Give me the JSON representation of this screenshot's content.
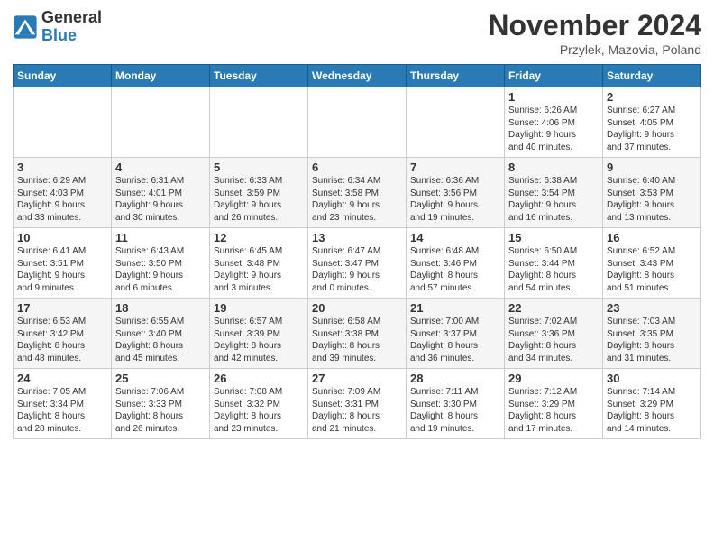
{
  "logo": {
    "general": "General",
    "blue": "Blue"
  },
  "title": "November 2024",
  "location": "Przylek, Mazovia, Poland",
  "headers": [
    "Sunday",
    "Monday",
    "Tuesday",
    "Wednesday",
    "Thursday",
    "Friday",
    "Saturday"
  ],
  "weeks": [
    [
      {
        "day": "",
        "info": ""
      },
      {
        "day": "",
        "info": ""
      },
      {
        "day": "",
        "info": ""
      },
      {
        "day": "",
        "info": ""
      },
      {
        "day": "",
        "info": ""
      },
      {
        "day": "1",
        "info": "Sunrise: 6:26 AM\nSunset: 4:06 PM\nDaylight: 9 hours\nand 40 minutes."
      },
      {
        "day": "2",
        "info": "Sunrise: 6:27 AM\nSunset: 4:05 PM\nDaylight: 9 hours\nand 37 minutes."
      }
    ],
    [
      {
        "day": "3",
        "info": "Sunrise: 6:29 AM\nSunset: 4:03 PM\nDaylight: 9 hours\nand 33 minutes."
      },
      {
        "day": "4",
        "info": "Sunrise: 6:31 AM\nSunset: 4:01 PM\nDaylight: 9 hours\nand 30 minutes."
      },
      {
        "day": "5",
        "info": "Sunrise: 6:33 AM\nSunset: 3:59 PM\nDaylight: 9 hours\nand 26 minutes."
      },
      {
        "day": "6",
        "info": "Sunrise: 6:34 AM\nSunset: 3:58 PM\nDaylight: 9 hours\nand 23 minutes."
      },
      {
        "day": "7",
        "info": "Sunrise: 6:36 AM\nSunset: 3:56 PM\nDaylight: 9 hours\nand 19 minutes."
      },
      {
        "day": "8",
        "info": "Sunrise: 6:38 AM\nSunset: 3:54 PM\nDaylight: 9 hours\nand 16 minutes."
      },
      {
        "day": "9",
        "info": "Sunrise: 6:40 AM\nSunset: 3:53 PM\nDaylight: 9 hours\nand 13 minutes."
      }
    ],
    [
      {
        "day": "10",
        "info": "Sunrise: 6:41 AM\nSunset: 3:51 PM\nDaylight: 9 hours\nand 9 minutes."
      },
      {
        "day": "11",
        "info": "Sunrise: 6:43 AM\nSunset: 3:50 PM\nDaylight: 9 hours\nand 6 minutes."
      },
      {
        "day": "12",
        "info": "Sunrise: 6:45 AM\nSunset: 3:48 PM\nDaylight: 9 hours\nand 3 minutes."
      },
      {
        "day": "13",
        "info": "Sunrise: 6:47 AM\nSunset: 3:47 PM\nDaylight: 9 hours\nand 0 minutes."
      },
      {
        "day": "14",
        "info": "Sunrise: 6:48 AM\nSunset: 3:46 PM\nDaylight: 8 hours\nand 57 minutes."
      },
      {
        "day": "15",
        "info": "Sunrise: 6:50 AM\nSunset: 3:44 PM\nDaylight: 8 hours\nand 54 minutes."
      },
      {
        "day": "16",
        "info": "Sunrise: 6:52 AM\nSunset: 3:43 PM\nDaylight: 8 hours\nand 51 minutes."
      }
    ],
    [
      {
        "day": "17",
        "info": "Sunrise: 6:53 AM\nSunset: 3:42 PM\nDaylight: 8 hours\nand 48 minutes."
      },
      {
        "day": "18",
        "info": "Sunrise: 6:55 AM\nSunset: 3:40 PM\nDaylight: 8 hours\nand 45 minutes."
      },
      {
        "day": "19",
        "info": "Sunrise: 6:57 AM\nSunset: 3:39 PM\nDaylight: 8 hours\nand 42 minutes."
      },
      {
        "day": "20",
        "info": "Sunrise: 6:58 AM\nSunset: 3:38 PM\nDaylight: 8 hours\nand 39 minutes."
      },
      {
        "day": "21",
        "info": "Sunrise: 7:00 AM\nSunset: 3:37 PM\nDaylight: 8 hours\nand 36 minutes."
      },
      {
        "day": "22",
        "info": "Sunrise: 7:02 AM\nSunset: 3:36 PM\nDaylight: 8 hours\nand 34 minutes."
      },
      {
        "day": "23",
        "info": "Sunrise: 7:03 AM\nSunset: 3:35 PM\nDaylight: 8 hours\nand 31 minutes."
      }
    ],
    [
      {
        "day": "24",
        "info": "Sunrise: 7:05 AM\nSunset: 3:34 PM\nDaylight: 8 hours\nand 28 minutes."
      },
      {
        "day": "25",
        "info": "Sunrise: 7:06 AM\nSunset: 3:33 PM\nDaylight: 8 hours\nand 26 minutes."
      },
      {
        "day": "26",
        "info": "Sunrise: 7:08 AM\nSunset: 3:32 PM\nDaylight: 8 hours\nand 23 minutes."
      },
      {
        "day": "27",
        "info": "Sunrise: 7:09 AM\nSunset: 3:31 PM\nDaylight: 8 hours\nand 21 minutes."
      },
      {
        "day": "28",
        "info": "Sunrise: 7:11 AM\nSunset: 3:30 PM\nDaylight: 8 hours\nand 19 minutes."
      },
      {
        "day": "29",
        "info": "Sunrise: 7:12 AM\nSunset: 3:29 PM\nDaylight: 8 hours\nand 17 minutes."
      },
      {
        "day": "30",
        "info": "Sunrise: 7:14 AM\nSunset: 3:29 PM\nDaylight: 8 hours\nand 14 minutes."
      }
    ]
  ]
}
